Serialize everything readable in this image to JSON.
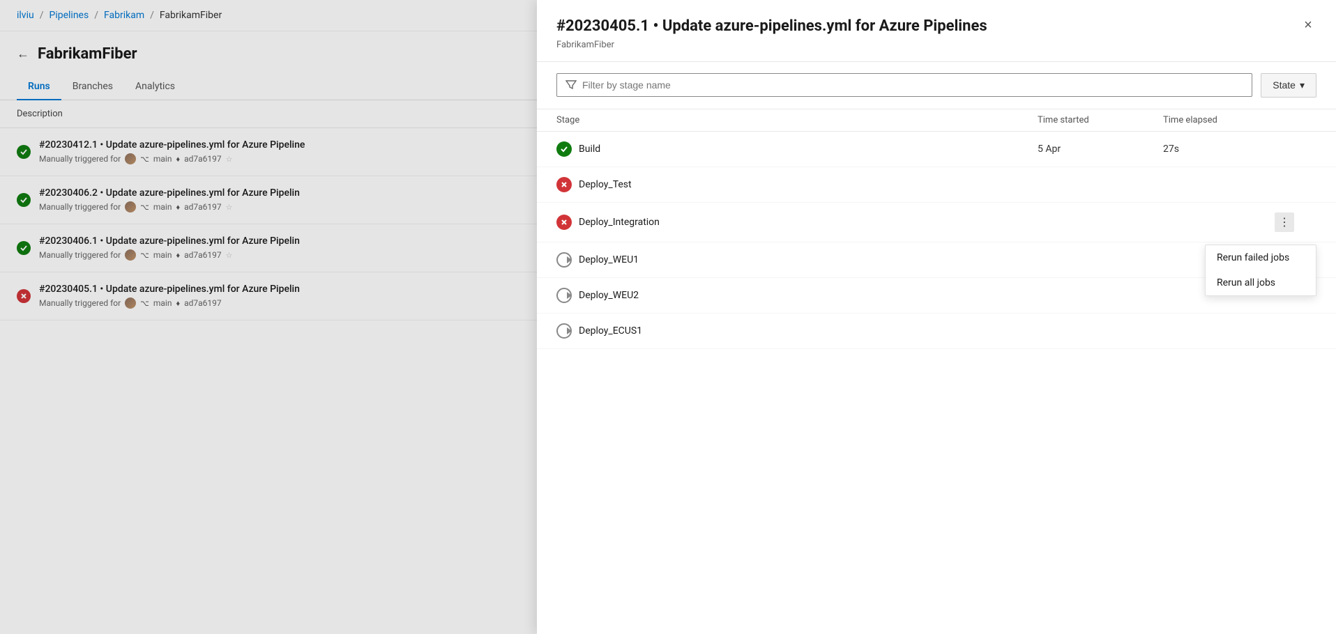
{
  "breadcrumb": {
    "items": [
      "ilviu",
      "Pipelines",
      "Fabrikam",
      "FabrikamFiber"
    ]
  },
  "pipeline": {
    "title": "FabrikamFiber",
    "back_label": "←"
  },
  "tabs": [
    {
      "label": "Runs",
      "active": true
    },
    {
      "label": "Branches",
      "active": false
    },
    {
      "label": "Analytics",
      "active": false
    }
  ],
  "table": {
    "description_col": "Description"
  },
  "runs": [
    {
      "id": "run1",
      "status": "success",
      "title": "#20230412.1 • Update azure-pipelines.yml for Azure Pipeline",
      "trigger": "Manually triggered for",
      "branch": "main",
      "commit": "ad7a6197"
    },
    {
      "id": "run2",
      "status": "success",
      "title": "#20230406.2 • Update azure-pipelines.yml for Azure Pipelin",
      "trigger": "Manually triggered for",
      "branch": "main",
      "commit": "ad7a6197"
    },
    {
      "id": "run3",
      "status": "success",
      "title": "#20230406.1 • Update azure-pipelines.yml for Azure Pipelin",
      "trigger": "Manually triggered for",
      "branch": "main",
      "commit": "ad7a6197"
    },
    {
      "id": "run4",
      "status": "failed",
      "title": "#20230405.1 • Update azure-pipelines.yml for Azure Pipelin",
      "trigger": "Manually triggered for",
      "branch": "main",
      "commit": "ad7a6197"
    }
  ],
  "panel": {
    "title": "#20230405.1 • Update azure-pipelines.yml for Azure Pipelines",
    "subtitle": "FabrikamFiber",
    "close_label": "×",
    "filter_placeholder": "Filter by stage name",
    "state_button": "State",
    "columns": {
      "stage": "Stage",
      "time_started": "Time started",
      "time_elapsed": "Time elapsed"
    },
    "stages": [
      {
        "id": "build",
        "name": "Build",
        "status": "success",
        "time_started": "5 Apr",
        "time_elapsed": "27s",
        "has_more": false
      },
      {
        "id": "deploy_test",
        "name": "Deploy_Test",
        "status": "failed",
        "time_started": "",
        "time_elapsed": "",
        "has_more": false
      },
      {
        "id": "deploy_integration",
        "name": "Deploy_Integration",
        "status": "failed",
        "time_started": "",
        "time_elapsed": "",
        "has_more": true
      },
      {
        "id": "deploy_weu1",
        "name": "Deploy_WEU1",
        "status": "pending",
        "time_started": "",
        "time_elapsed": "",
        "has_more": false
      },
      {
        "id": "deploy_weu2",
        "name": "Deploy_WEU2",
        "status": "pending",
        "time_started": "",
        "time_elapsed": "",
        "has_more": false
      },
      {
        "id": "deploy_ecus1",
        "name": "Deploy_ECUS1",
        "status": "pending",
        "time_started": "",
        "time_elapsed": "",
        "has_more": false
      }
    ],
    "context_menu": {
      "items": [
        {
          "id": "rerun_failed",
          "label": "Rerun failed jobs"
        },
        {
          "id": "rerun_all",
          "label": "Rerun all jobs"
        }
      ]
    }
  }
}
